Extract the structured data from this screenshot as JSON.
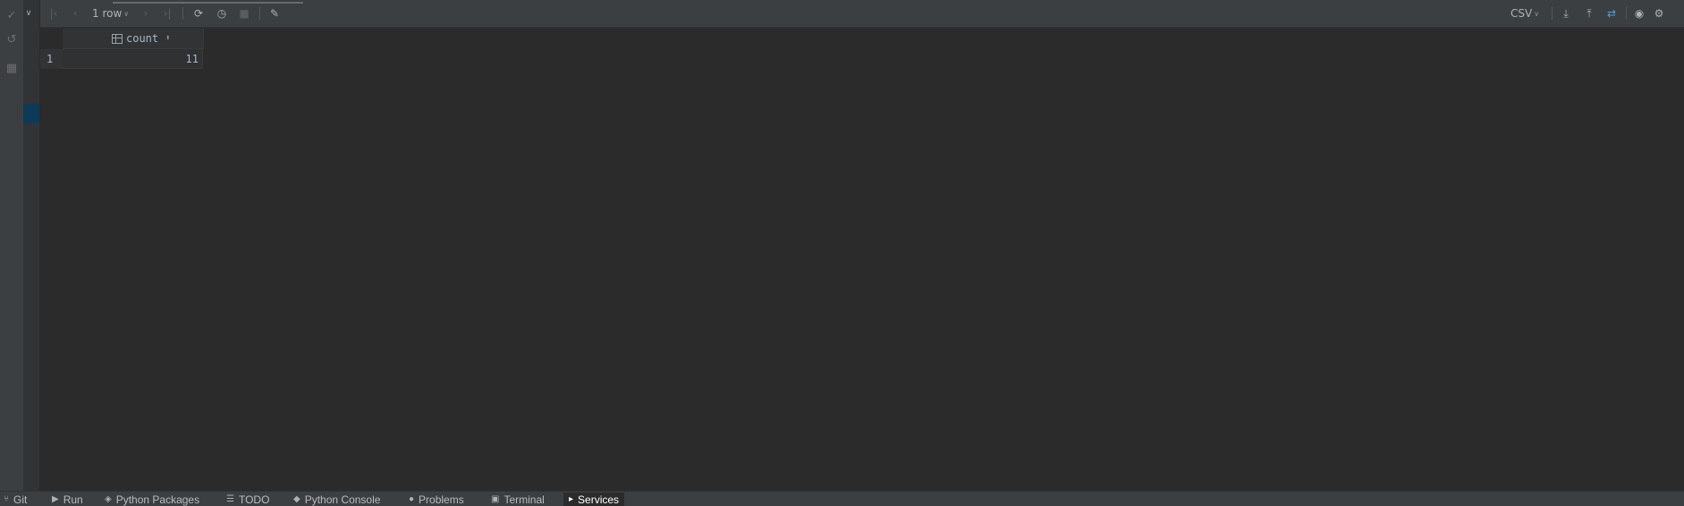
{
  "toolbar": {
    "row_count_label": "1 row",
    "export_format": "CSV"
  },
  "grid": {
    "column_header": "count",
    "rows": [
      {
        "row_number": "1",
        "count": "11"
      }
    ]
  },
  "bottom_tabs": [
    {
      "label": "Git",
      "icon": "git-branch-icon"
    },
    {
      "label": "Run",
      "icon": "run-play-icon"
    },
    {
      "label": "Python Packages",
      "icon": "packages-layers-icon"
    },
    {
      "label": "TODO",
      "icon": "todo-list-icon"
    },
    {
      "label": "Python Console",
      "icon": "python-console-icon"
    },
    {
      "label": "Problems",
      "icon": "problems-info-icon"
    },
    {
      "label": "Terminal",
      "icon": "terminal-icon"
    },
    {
      "label": "Services",
      "icon": "services-icon",
      "active": true
    }
  ]
}
